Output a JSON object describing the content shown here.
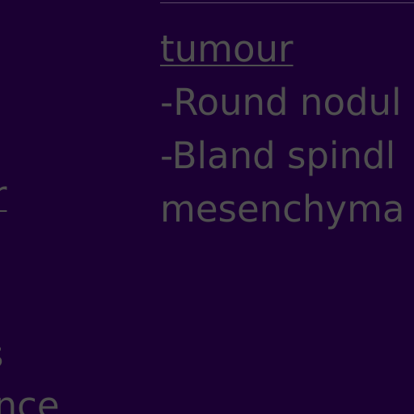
{
  "right_column": {
    "lines": [
      "tumour",
      "-Round nodul",
      "-Bland spindl",
      "mesenchyma"
    ]
  },
  "left_column_fragments": {
    "r": "r",
    "s": "s",
    "ance": "ance"
  },
  "colors": {
    "background": "#1b0033",
    "text": "#4f4f4f"
  }
}
